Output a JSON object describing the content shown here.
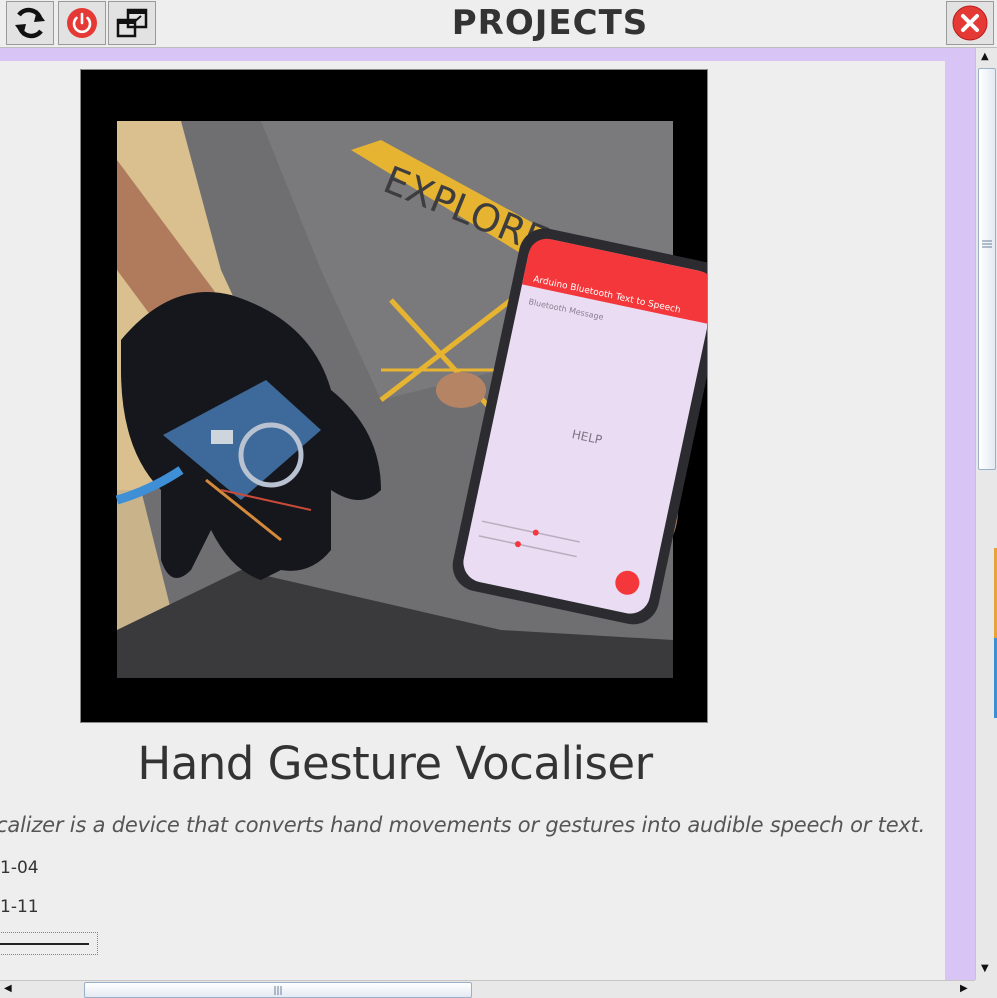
{
  "window": {
    "title": "PROJECTS",
    "buttons": {
      "refresh_icon": "refresh-icon",
      "power_icon": "power-icon",
      "restore_icon": "restore-window-icon",
      "close_icon": "close-icon"
    }
  },
  "project": {
    "title": "Hand Gesture Vocaliser",
    "description": "e vocalizer is a device that converts hand movements or gestures into audible speech or text.",
    "date_start": "1-04",
    "date_end": "1-11",
    "image": {
      "phone_header": "Arduino Bluetooth Text to Speech",
      "phone_subheader": "Bluetooth Message",
      "phone_message": "HELP",
      "shirt_text": "EXPLORE"
    }
  },
  "colors": {
    "accent_purple": "#d9c4f6",
    "close_red": "#e53935",
    "power_red": "#e53935",
    "phone_red": "#f4373a"
  }
}
